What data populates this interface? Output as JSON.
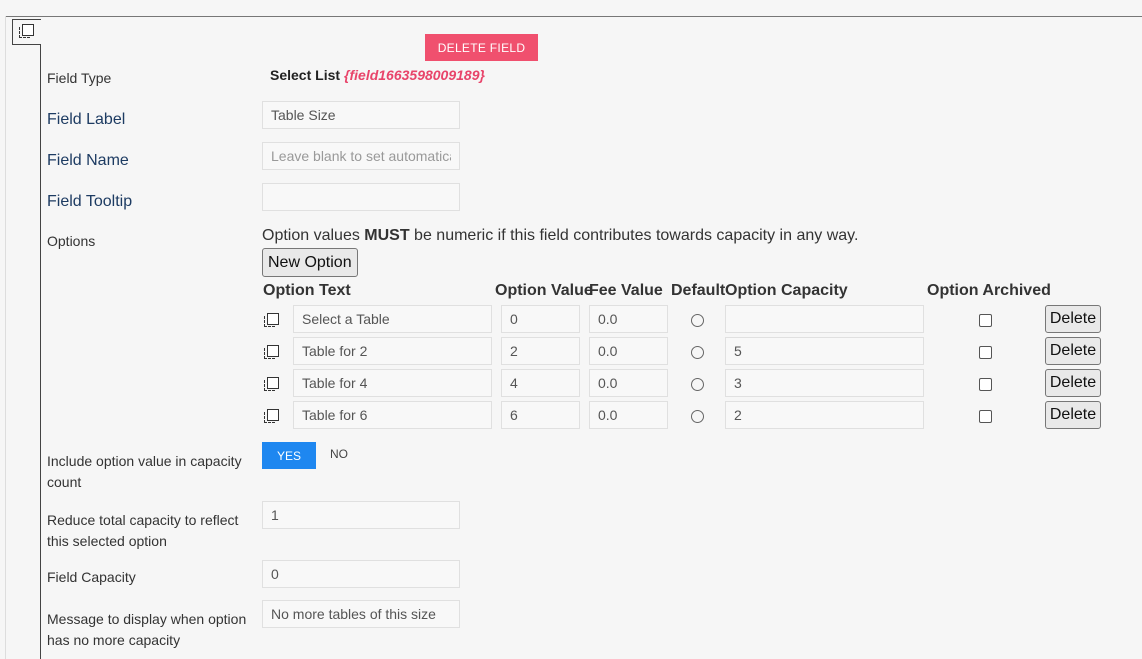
{
  "header": {
    "delete_field_label": "DELETE FIELD"
  },
  "field_type": {
    "label": "Field Type",
    "type_name": "Select List",
    "field_id": "{field1663598009189}"
  },
  "field_label": {
    "label": "Field Label",
    "value": "Table Size"
  },
  "field_name": {
    "label": "Field Name",
    "placeholder": "Leave blank to set automatically"
  },
  "field_tooltip": {
    "label": "Field Tooltip",
    "value": ""
  },
  "options": {
    "label": "Options",
    "note_prefix": "Option values ",
    "note_bold": "MUST",
    "note_suffix": " be numeric if this field contributes towards capacity in any way.",
    "new_option_label": "New Option",
    "headers": {
      "text": "Option Text",
      "value": "Option Value",
      "fee": "Fee Value",
      "default": "Default",
      "capacity": "Option Capacity",
      "archived": "Option Archived"
    },
    "delete_label": "Delete",
    "rows": [
      {
        "text": "Select a Table",
        "value": "0",
        "fee": "0.0",
        "capacity": ""
      },
      {
        "text": "Table for 2",
        "value": "2",
        "fee": "0.0",
        "capacity": "5"
      },
      {
        "text": "Table for 4",
        "value": "4",
        "fee": "0.0",
        "capacity": "3"
      },
      {
        "text": "Table for 6",
        "value": "6",
        "fee": "0.0",
        "capacity": "2"
      }
    ]
  },
  "include_capacity": {
    "label_line1": "Include option value in capacity",
    "label_line2": "count",
    "yes_label": "YES",
    "no_label": "NO"
  },
  "reduce_capacity": {
    "label_line1": "Reduce total capacity to reflect",
    "label_line2": "this selected option",
    "value": "1"
  },
  "field_capacity": {
    "label": "Field Capacity",
    "value": "0"
  },
  "no_capacity_message": {
    "label_line1": "Message to display when option",
    "label_line2": "has no more capacity",
    "value": "No more tables of this size"
  }
}
